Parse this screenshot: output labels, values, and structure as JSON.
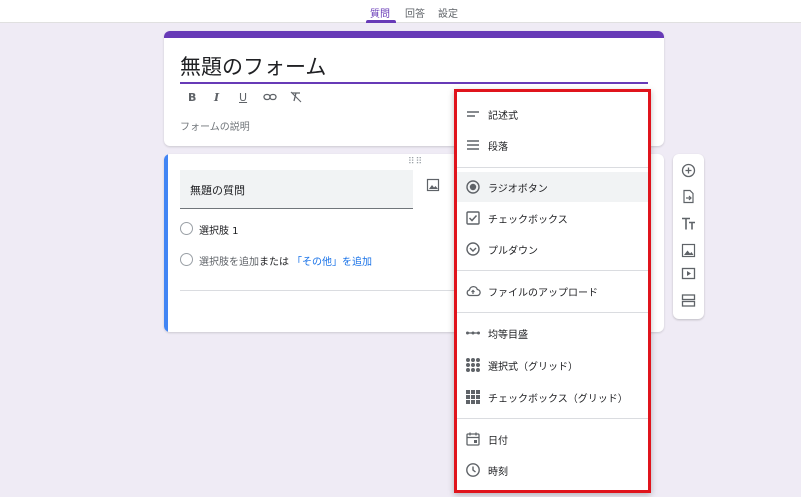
{
  "tabs": [
    {
      "label": "質問",
      "active": true
    },
    {
      "label": "回答",
      "active": false
    },
    {
      "label": "設定",
      "active": false
    }
  ],
  "form": {
    "title": "無題のフォーム",
    "description_placeholder": "フォームの説明",
    "format_buttons": [
      "B",
      "I",
      "U",
      "link",
      "clear-format"
    ]
  },
  "question": {
    "title": "無題の質問",
    "option1": "選択肢 1",
    "add_option": "選択肢を追加",
    "or": "または",
    "add_other": "「その他」を追加"
  },
  "menu": {
    "items": [
      {
        "label": "記述式",
        "icon": "short-answer-icon"
      },
      {
        "label": "段落",
        "icon": "paragraph-icon"
      },
      {
        "label": "ラジオボタン",
        "icon": "radio-icon",
        "selected": true
      },
      {
        "label": "チェックボックス",
        "icon": "checkbox-icon"
      },
      {
        "label": "プルダウン",
        "icon": "dropdown-icon"
      },
      {
        "label": "ファイルのアップロード",
        "icon": "cloud-upload-icon"
      },
      {
        "label": "均等目盛",
        "icon": "linear-scale-icon"
      },
      {
        "label": "選択式（グリッド）",
        "icon": "dot-grid-icon"
      },
      {
        "label": "チェックボックス（グリッド）",
        "icon": "checkbox-grid-icon"
      },
      {
        "label": "日付",
        "icon": "calendar-icon"
      },
      {
        "label": "時刻",
        "icon": "clock-icon"
      }
    ]
  },
  "side_toolbar": [
    "add-question-icon",
    "import-questions-icon",
    "add-title-icon",
    "add-image-icon",
    "add-video-icon",
    "add-section-icon"
  ],
  "colors": {
    "accent": "#673ab7",
    "highlight_border": "#e0141c",
    "link": "#1a73e8"
  }
}
